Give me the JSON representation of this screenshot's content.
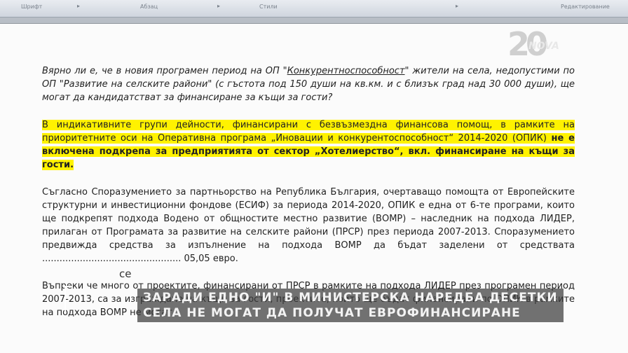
{
  "toolbar": {
    "groups": [
      "Шрифт",
      "Абзац",
      "Стили",
      "Редактирование"
    ]
  },
  "logo": {
    "number": "20",
    "brand": "NOVA"
  },
  "document": {
    "p1": {
      "a": "Вярно ли е, че в новия програмен период на ОП \"",
      "b": "Конкурентноспособност",
      "c": "\" жители на села, недопустими по ОП \"Развитие на селските райони\" (с гъстота под 150 души на кв.км. и с близък град над 30 000 души), ще могат да кандидатстват за финансиране за къщи за гости?"
    },
    "p2": {
      "normal": "В индикативните групи дейности, финансирани с безвъзмездна финансова помощ, в рамките на приоритетните оси на Оперативна програма „Иновации и конкурентоспособност“ 2014-2020 (ОПИК) ",
      "bold": "не е включена подкрепа за предприятията от сектор „Хотелиерство“, вкл. финансиране на къщи за гости."
    },
    "p3": "Съгласно Споразумението за партньорство на Република България, очертаващо помощта от Европейските структурни и инвестиционни фондове (ЕСИФ) за периода 2014-2020, ОПИК е една от 6-те програми, които ще подкрепят подхода Водено от общностите местно развитие (ВОМР) – наследник на подхода ЛИДЕР, прилаган от Програмата за развитие на селските райони (ПРСР) през периода 2007-2013. Споразумението предвижда средства за изпълнение на подхода ВОМР да бъдат заделени от средствата ................................................ 05,05 евро.",
    "p4": "Въпреки че много от проектите, финансирани от ПРСР в рамките на подхода ЛИДЕР през програмен период 2007-2013, са за изграждане на къщи за гости, проектите, които ще бъдат финансирани по ОПИК в рамките на подхода ВОМР не могат"
  },
  "overlay": {
    "small_text": "се",
    "ticker_line1": "ЗАРАДИ ЕДНО \"И\" В МИНИСТЕРСКА НАРЕДБА ДЕСЕТКИ",
    "ticker_line2": "СЕЛА НЕ МОГАТ ДА ПОЛУЧАТ ЕВРОФИНАНСИРАНЕ"
  }
}
